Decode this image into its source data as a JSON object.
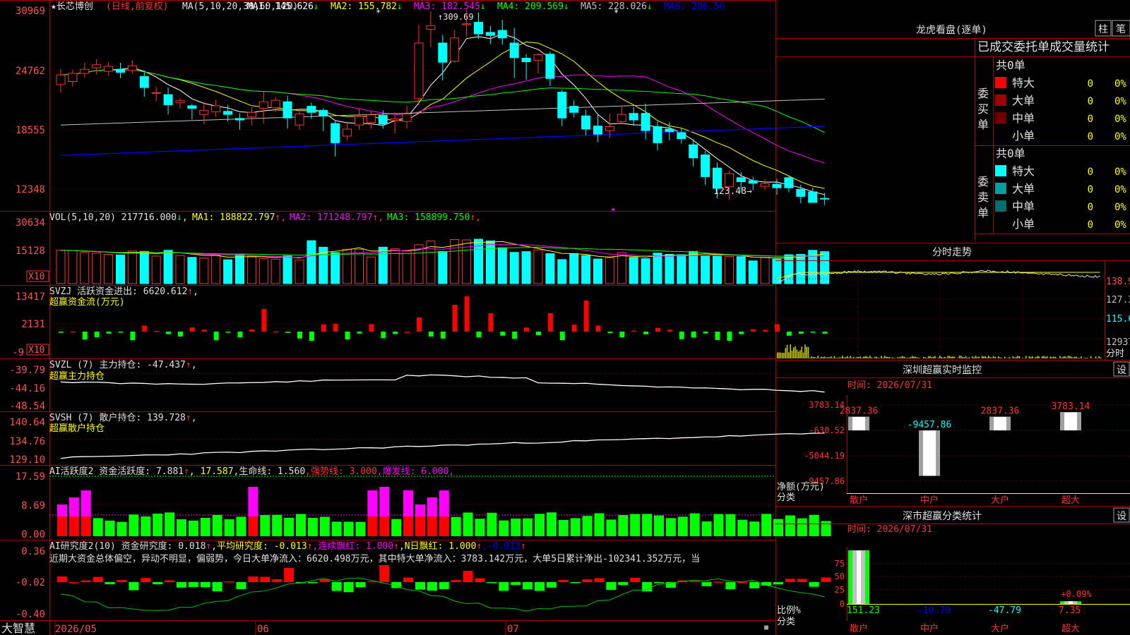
{
  "header": {
    "stock": "★长芯博创",
    "mode": "(日线,前复权)",
    "ma_def": "MA(5,10,20,30,60,120)",
    "ma_items": [
      {
        "label": "MA1: 145.626",
        "arrow": "↓",
        "color": "#ffffff"
      },
      {
        "label": "MA2: 155.782",
        "arrow": "↓",
        "color": "#ffff00"
      },
      {
        "label": "MA3: 182.545",
        "arrow": "↓",
        "color": "#ff00ff"
      },
      {
        "label": "MA4: 209.569",
        "arrow": "↓",
        "color": "#00ff00"
      },
      {
        "label": "MA5: 228.026",
        "arrow": "↓",
        "color": "#c0c0c0"
      },
      {
        "label": "MA6: 206.56",
        "arrow": "",
        "color": "#0000ff"
      }
    ],
    "high_label": "309.69",
    "low_label": "123.48"
  },
  "colors": {
    "up": "#ff3232",
    "down": "#00ffff",
    "grid": "#8b0000",
    "frame": "#b00000",
    "axis_text": "#ff5050"
  },
  "price_axis": [
    "30969",
    "24762",
    "18555",
    "12348"
  ],
  "vol": {
    "title": "VOL(5,10,20)",
    "value": "217716.000",
    "arrow": "↓",
    "items": [
      {
        "label": "MA1: 188822.797",
        "arrow": "↑",
        "color": "#ffff00"
      },
      {
        "label": "MA2: 171248.797",
        "arrow": "↑",
        "color": "#ff00ff"
      },
      {
        "label": "MA3: 158899.750",
        "arrow": "↑",
        "color": "#00ff00"
      }
    ],
    "axis": [
      "30634",
      "15128"
    ],
    "mult": "X10"
  },
  "svzj": {
    "title": "SVZJ  活跃资金进出: 6620.612",
    "arrow": "↑",
    "suffix": ",",
    "sub": "超赢资金流(万元)",
    "axis": [
      "13417",
      "2131",
      "-9"
    ],
    "mult": "X10"
  },
  "svzl": {
    "title": "SVZL (7) 主力持仓: -47.437",
    "arrow": "↑",
    "suffix": ",",
    "sub": "超赢主力持仓",
    "axis": [
      "-39.79",
      "-44.16",
      "-48.54"
    ]
  },
  "svsh": {
    "title": "SVSH (7) 散户持仓: 139.728",
    "arrow": "↑",
    "suffix": ",",
    "sub": "超赢散户持仓",
    "axis": [
      "140.64",
      "134.76",
      "129.10"
    ]
  },
  "ai1": {
    "items": [
      {
        "text": "AI活跃度2 资金活跃度: 7.881",
        "color": "#e0e0e0"
      },
      {
        "text": "↑",
        "color": "#ff3232"
      },
      {
        "text": ", 17.587",
        "color": "#ffff00"
      },
      {
        "text": ",生命线: 1.560",
        "color": "#e0e0e0"
      },
      {
        "text": ",强势线: 3.000",
        "color": "#ff3232"
      },
      {
        "text": ",爆发线: 6.000,",
        "color": "#ff00ff"
      }
    ],
    "axis": [
      "17.59",
      "8.69",
      "0.00"
    ]
  },
  "ai2": {
    "items": [
      {
        "text": "AI研究度2(10) 资金研究度: 0.018",
        "color": "#e0e0e0"
      },
      {
        "text": "↑",
        "color": "#ff3232"
      },
      {
        "text": ",平均研究度: -0.013",
        "color": "#ffff00"
      },
      {
        "text": "↑",
        "color": "#ff3232"
      },
      {
        "text": ",连续飘红: 1.000",
        "color": "#ff00ff"
      },
      {
        "text": "↑",
        "color": "#ff3232"
      },
      {
        "text": ",N日飘红: 1.000",
        "color": "#ffff00"
      },
      {
        "text": "↑",
        "color": "#ff3232"
      },
      {
        "text": ",-0.013",
        "color": "#0000ff"
      },
      {
        "text": "↑",
        "color": "#ff3232"
      }
    ],
    "summary": "近期大资金总体偏空，异动不明显，偏弱势，今日大单净流入：6620.498万元，其中特大单净流入：3783.142万元，大单5日累计净出-102341.352万元，当",
    "axis": [
      "0.36",
      "-0.02",
      "-0.40"
    ]
  },
  "footer": {
    "brand": "大智慧",
    "months": [
      "2026/05",
      "06",
      "07"
    ]
  },
  "right": {
    "title": "龙虎看盘(逐单)",
    "tab_bar": "柱",
    "tab_pen": "笔",
    "heading": "已成交委托单成交量统计",
    "buy": {
      "label_chars": [
        "委",
        "买",
        "单"
      ],
      "total": "共0单",
      "rows": [
        {
          "label": "特大",
          "value": "0",
          "pct": "0%",
          "color": "#ff0000"
        },
        {
          "label": "大单",
          "value": "0",
          "pct": "0%",
          "color": "#a00000"
        },
        {
          "label": "中单",
          "value": "0",
          "pct": "0%",
          "color": "#700000"
        },
        {
          "label": "小单",
          "value": "0",
          "pct": "0%",
          "color": "#000000"
        }
      ]
    },
    "sell": {
      "label_chars": [
        "委",
        "卖",
        "单"
      ],
      "total": "共0单",
      "rows": [
        {
          "label": "特大",
          "value": "0",
          "pct": "0%",
          "color": "#00ffff"
        },
        {
          "label": "大单",
          "value": "0",
          "pct": "0%",
          "color": "#00a0a0"
        },
        {
          "label": "中单",
          "value": "0",
          "pct": "0%",
          "color": "#007070"
        },
        {
          "label": "小单",
          "value": "0",
          "pct": "0%",
          "color": "#000000"
        }
      ]
    },
    "intraday": {
      "title": "分时走势",
      "axis": [
        "138.9",
        "127.3",
        "115.6",
        "12937",
        "分时"
      ]
    },
    "monitor": {
      "title": "深圳超赢实时监控",
      "set": "设",
      "time": "时间: 2026/07/31",
      "axis": [
        "3783.14",
        "-630.52",
        "-5044.19",
        "-9457.86"
      ],
      "ylabel1": "净额(万元)",
      "ylabel2": "分类",
      "categories": [
        "散户",
        "中户",
        "大户",
        "超大"
      ],
      "values": [
        2837.36,
        -9457.86,
        2837.36,
        3783.14
      ],
      "value_labels": [
        "2837.36",
        "-9457.86",
        "2837.36",
        "3783.14"
      ]
    },
    "stats": {
      "title": "深市超赢分类统计",
      "set": "设",
      "time": "时间: 2026/07/31",
      "axis": [
        "75",
        "50",
        "25",
        "0"
      ],
      "ylabel1": "比例%",
      "ylabel2": "分类",
      "categories": [
        "散户",
        "中户",
        "大户",
        "超大"
      ],
      "bar_values": [
        100,
        0,
        0,
        5
      ],
      "value_labels": [
        "151.23",
        "-10.79",
        "-47.79",
        "7.35"
      ],
      "value_colors": [
        "#00ff00",
        "#0000ff",
        "#00ffff",
        "#ff3232"
      ],
      "annotation": "+0.09%"
    }
  },
  "chart_data": {
    "type": "candlestick",
    "x_labels": [
      "2026/05",
      "06",
      "07"
    ],
    "candles": [
      [
        240.0,
        249.5,
        232.0,
        255.5
      ],
      [
        243.0,
        251.0,
        238.0,
        254.5
      ],
      [
        251.0,
        255.0,
        247.5,
        261.5
      ],
      [
        256.5,
        259.5,
        250.0,
        265.0
      ],
      [
        253.0,
        258.0,
        248.5,
        262.0
      ],
      [
        255.0,
        252.0,
        246.5,
        261.5
      ],
      [
        254.0,
        258.5,
        250.5,
        264.0
      ],
      [
        248.0,
        237.0,
        228.0,
        254.0
      ],
      [
        231.5,
        232.0,
        223.5,
        238.0
      ],
      [
        230.0,
        220.0,
        210.5,
        237.0
      ],
      [
        222.0,
        224.0,
        216.0,
        226.5
      ],
      [
        219.0,
        216.5,
        205.5,
        221.0
      ],
      [
        210.5,
        214.5,
        201.0,
        222.5
      ],
      [
        213.0,
        219.0,
        208.0,
        225.0
      ],
      [
        213.5,
        210.5,
        203.5,
        220.0
      ],
      [
        206.5,
        205.0,
        195.5,
        211.5
      ],
      [
        208.0,
        212.5,
        199.5,
        217.5
      ],
      [
        216.5,
        223.0,
        201.5,
        233.0
      ],
      [
        217.0,
        224.5,
        212.5,
        227.5
      ],
      [
        223.0,
        207.0,
        196.5,
        229.0
      ],
      [
        200.0,
        211.0,
        195.5,
        215.0
      ],
      [
        218.5,
        212.5,
        206.0,
        222.0
      ],
      [
        214.5,
        209.0,
        194.0,
        216.5
      ],
      [
        201.5,
        182.5,
        169.0,
        204.5
      ],
      [
        189.0,
        196.0,
        185.0,
        203.5
      ],
      [
        200.0,
        208.5,
        195.5,
        216.0
      ],
      [
        202.5,
        210.0,
        196.5,
        214.0
      ],
      [
        209.5,
        201.0,
        196.5,
        214.5
      ],
      [
        204.5,
        206.0,
        191.5,
        212.5
      ],
      [
        203.5,
        211.0,
        196.5,
        219.0
      ],
      [
        226.0,
        281.0,
        219.5,
        299.0
      ],
      [
        294.5,
        298.0,
        277.0,
        312.5
      ],
      [
        281.0,
        262.0,
        244.0,
        289.0
      ],
      [
        263.0,
        286.0,
        261.5,
        294.0
      ],
      [
        299.0,
        300.0,
        287.5,
        314.0
      ],
      [
        301.5,
        290.0,
        285.0,
        311.0
      ],
      [
        291.5,
        288.5,
        280.0,
        298.0
      ],
      [
        293.5,
        286.0,
        279.5,
        304.0
      ],
      [
        281.0,
        266.5,
        246.5,
        296.0
      ],
      [
        266.0,
        262.5,
        244.5,
        270.0
      ],
      [
        264.0,
        269.5,
        251.0,
        270.5
      ],
      [
        270.0,
        246.0,
        238.5,
        272.5
      ],
      [
        232.5,
        207.0,
        199.0,
        235.0
      ],
      [
        218.5,
        212.5,
        207.5,
        224.5
      ],
      [
        209.0,
        196.0,
        190.0,
        215.0
      ],
      [
        199.0,
        191.0,
        183.0,
        210.0
      ],
      [
        194.5,
        198.5,
        187.0,
        211.0
      ],
      [
        203.5,
        210.5,
        200.5,
        219.0
      ],
      [
        211.5,
        205.0,
        199.0,
        217.5
      ],
      [
        211.5,
        194.5,
        186.0,
        221.0
      ],
      [
        198.5,
        182.5,
        175.0,
        203.5
      ],
      [
        196.0,
        193.5,
        185.0,
        203.0
      ],
      [
        192.5,
        186.5,
        181.5,
        197.0
      ],
      [
        180.5,
        167.5,
        159.0,
        186.0
      ],
      [
        170.5,
        149.0,
        141.0,
        174.5
      ],
      [
        157.5,
        137.5,
        127.5,
        163.0
      ],
      [
        139.0,
        152.0,
        126.0,
        155.0
      ],
      [
        148.0,
        144.0,
        134.5,
        153.5
      ],
      [
        145.0,
        142.5,
        135.5,
        149.0
      ],
      [
        139.5,
        142.0,
        135.5,
        146.5
      ],
      [
        141.5,
        138.0,
        131.0,
        147.0
      ],
      [
        148.0,
        138.0,
        133.5,
        149.0
      ],
      [
        136.5,
        129.5,
        122.5,
        141.0
      ],
      [
        134.0,
        123.5,
        123.5,
        138.0
      ],
      [
        127.5,
        127.0,
        121.0,
        133.0
      ]
    ],
    "volume": [
      18000,
      17800,
      17000,
      16500,
      15800,
      15500,
      17600,
      17400,
      14900,
      18000,
      15200,
      14200,
      13800,
      15300,
      12900,
      16000,
      14900,
      13500,
      13200,
      15000,
      12800,
      23200,
      19700,
      16800,
      18600,
      18500,
      14400,
      19700,
      18800,
      17600,
      21000,
      23000,
      17400,
      23800,
      23600,
      24000,
      23100,
      19400,
      16900,
      17300,
      18200,
      16200,
      13000,
      16200,
      15200,
      13300,
      14000,
      16800,
      14200,
      13500,
      16500,
      15800,
      15600,
      17400,
      14900,
      14800,
      14700,
      14600,
      12300,
      14300,
      13300,
      15600,
      15800,
      18000,
      17300
    ]
  }
}
